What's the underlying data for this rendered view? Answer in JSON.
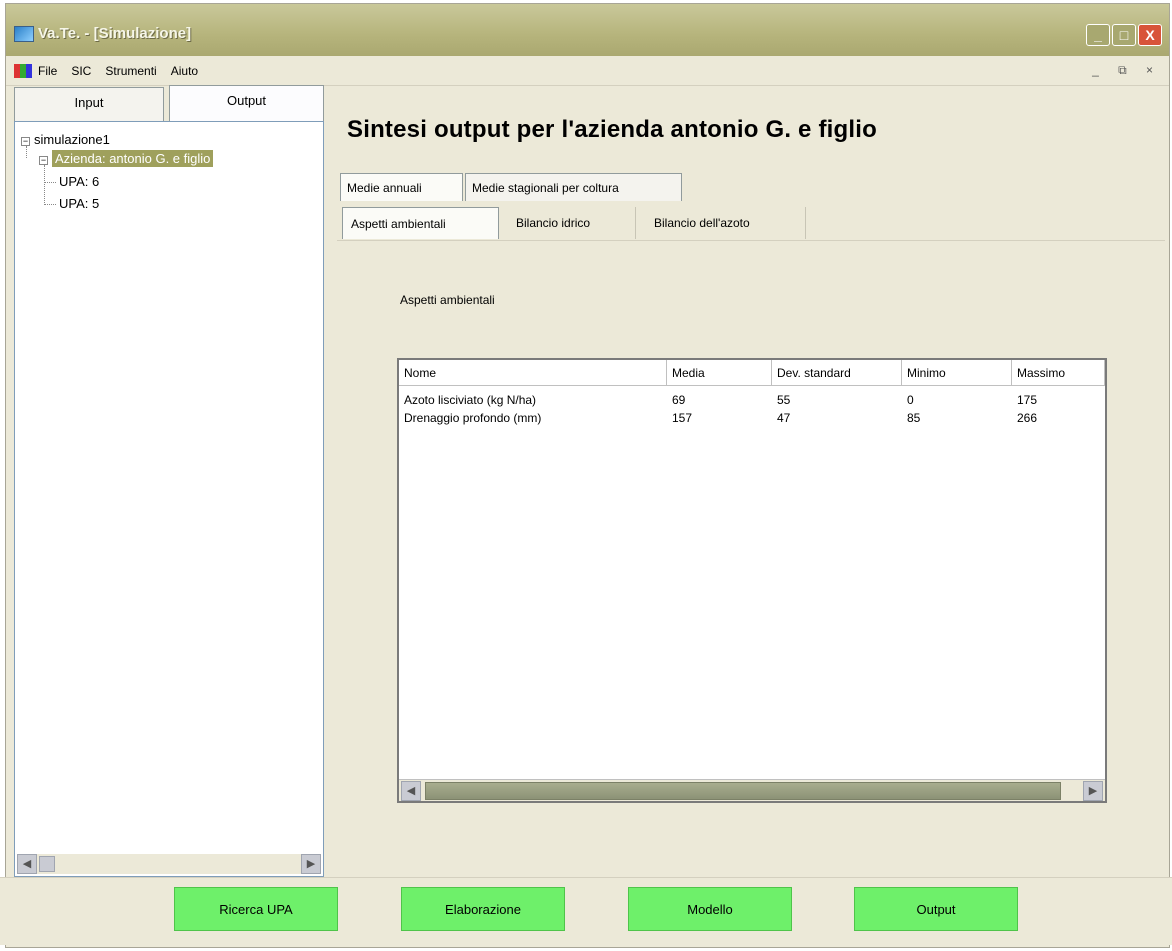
{
  "window": {
    "title": "Va.Te. - [Simulazione]",
    "controls": {
      "minimize": "_",
      "maximize": "□",
      "close": "X"
    }
  },
  "menu": {
    "items": [
      "File",
      "SIC",
      "Strumenti",
      "Aiuto"
    ],
    "mdi_controls": "_ ⧉ ×"
  },
  "left_panel": {
    "tabs": [
      "Input",
      "Output"
    ],
    "active_tab": "Output",
    "tree": {
      "root": "simulazione1",
      "company": "Azienda: antonio G. e figlio",
      "children": [
        "UPA: 6",
        "UPA: 5"
      ]
    }
  },
  "main": {
    "title": "Sintesi output per l'azienda antonio G. e figlio",
    "tabs_level1": [
      "Medie annuali",
      "Medie stagionali per coltura"
    ],
    "tabs_level2": [
      "Aspetti ambientali",
      "Bilancio idrico",
      "Bilancio dell'azoto"
    ],
    "section_label": "Aspetti ambientali",
    "table": {
      "columns": [
        "Nome",
        "Media",
        "Dev. standard",
        "Minimo",
        "Massimo"
      ],
      "rows": [
        [
          "Azoto lisciviato (kg N/ha)",
          "69",
          "55",
          "0",
          "175"
        ],
        [
          "Drenaggio profondo (mm)",
          "157",
          "47",
          "85",
          "266"
        ]
      ]
    }
  },
  "bottom_buttons": [
    "Ricerca UPA",
    "Elaborazione",
    "Modello",
    "Output"
  ],
  "colors": {
    "window_bg": "#ece9d8",
    "titlebar": "#b6b47c",
    "selected_tree": "#9fa05c",
    "green_button": "#6ef06a"
  }
}
